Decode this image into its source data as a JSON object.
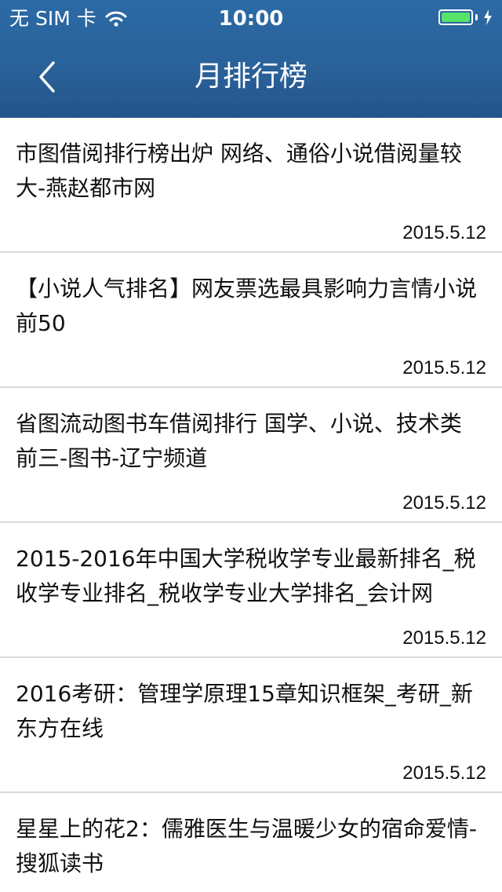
{
  "status_bar": {
    "carrier": "无 SIM 卡",
    "time": "10:00",
    "battery_level": 1.0,
    "battery_color": "#57e26a",
    "icons": [
      "wifi-icon",
      "battery-icon",
      "charging-icon"
    ]
  },
  "nav": {
    "title": "月排行榜",
    "back_icon": "chevron-left-icon",
    "bar_color": "#2a629a"
  },
  "items": [
    {
      "title": "市图借阅排行榜出炉 网络、通俗小说借阅量较大-燕赵都市网",
      "date": "2015.5.12"
    },
    {
      "title": "【小说人气排名】网友票选最具影响力言情小说前50",
      "date": "2015.5.12"
    },
    {
      "title": "省图流动图书车借阅排行 国学、小说、技术类前三-图书-辽宁频道",
      "date": "2015.5.12"
    },
    {
      "title": "2015-2016年中国大学税收学专业最新排名_税收学专业排名_税收学专业大学排名_会计网",
      "date": "2015.5.12"
    },
    {
      "title": "2016考研：管理学原理15章知识框架_考研_新东方在线",
      "date": "2015.5.12"
    },
    {
      "title": "星星上的花2：儒雅医生与温暖少女的宿命爱情-搜狐读书",
      "date": ""
    }
  ]
}
